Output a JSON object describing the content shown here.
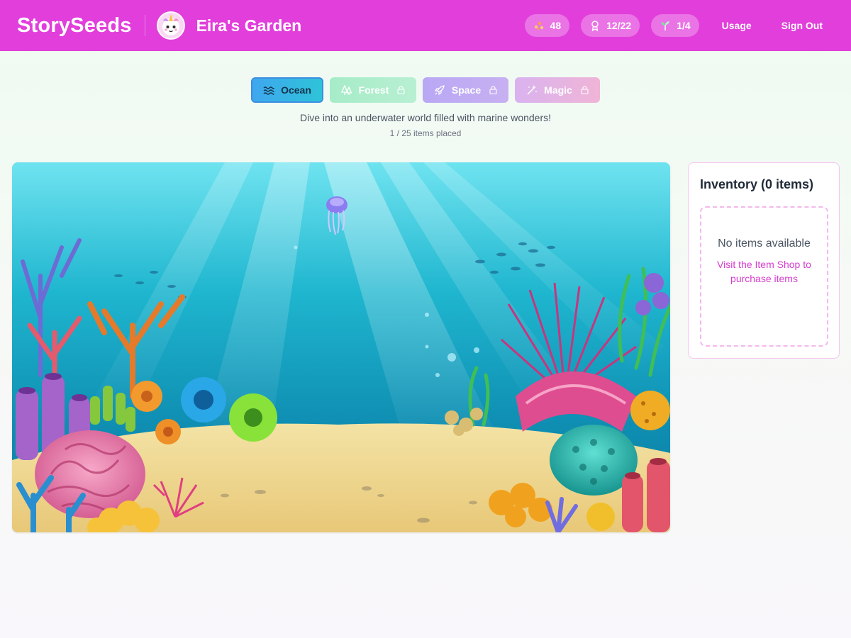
{
  "header": {
    "brand": "StorySeeds",
    "garden_title": "Eira's Garden",
    "avatar_icon": "unicorn-icon",
    "stats": [
      {
        "icon": "seeds-icon",
        "value": "48"
      },
      {
        "icon": "badge-icon",
        "value": "12/22"
      },
      {
        "icon": "sprout-icon",
        "value": "1/4"
      }
    ],
    "usage_label": "Usage",
    "signout_label": "Sign Out",
    "accent_color": "#e23edb"
  },
  "themes": {
    "tabs": [
      {
        "label": "Ocean",
        "icon": "waves-icon",
        "locked": false,
        "selected": true
      },
      {
        "label": "Forest",
        "icon": "trees-icon",
        "locked": true,
        "selected": false
      },
      {
        "label": "Space",
        "icon": "rocket-icon",
        "locked": true,
        "selected": false
      },
      {
        "label": "Magic",
        "icon": "wand-icon",
        "locked": true,
        "selected": false
      }
    ],
    "tagline": "Dive into an underwater world filled with marine wonders!",
    "items_placed": "1 / 25 items placed"
  },
  "scene": {
    "image": "underwater-coral-reef-scene"
  },
  "inventory": {
    "title": "Inventory (0 items)",
    "empty_title": "No items available",
    "empty_link": "Visit the Item Shop to purchase items"
  }
}
